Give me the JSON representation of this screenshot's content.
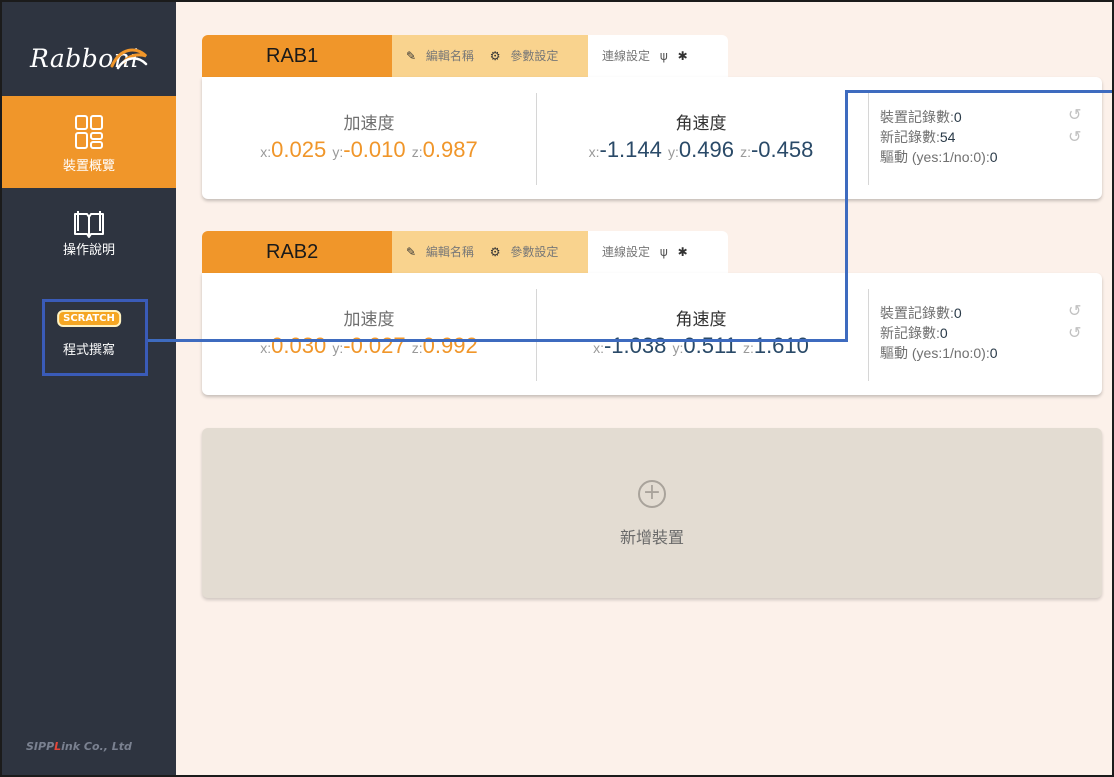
{
  "sidebar": {
    "logo_text": "Rabboni",
    "nav": [
      {
        "label": "裝置概覽",
        "icon": "grid-icon",
        "active": true
      },
      {
        "label": "操作說明",
        "icon": "book-icon",
        "active": false
      },
      {
        "label": "程式撰寫",
        "icon": "scratch-logo",
        "badge": "SCRATCH",
        "active": false
      }
    ],
    "footer": {
      "prefix": "SIPP",
      "accent": "L",
      "suffix": "ink Co., Ltd"
    }
  },
  "devices": [
    {
      "name": "RAB1",
      "actions": {
        "edit_icon": "✎",
        "edit_label": "編輯名稱",
        "settings_icon": "⚙",
        "settings_label": "參數設定"
      },
      "connection": {
        "label": "連線設定",
        "usb_icon": "ψ",
        "bluetooth_icon": "✱"
      },
      "accel": {
        "title": "加速度",
        "x_label": "x:",
        "x": "0.025",
        "y_label": "y:",
        "y": "-0.010",
        "z_label": "z:",
        "z": "0.987"
      },
      "gyro": {
        "title": "角速度",
        "x_label": "x:",
        "x": "-1.144",
        "y_label": "y:",
        "y": "0.496",
        "z_label": "z:",
        "z": "-0.458"
      },
      "stats": {
        "device_records_label": "裝置記錄數:",
        "device_records": "0",
        "new_records_label": "新記錄數:",
        "new_records": "54",
        "driver_label": "驅動 (yes:1/no:0):",
        "driver": "0"
      },
      "reset_icon": "↺"
    },
    {
      "name": "RAB2",
      "actions": {
        "edit_icon": "✎",
        "edit_label": "編輯名稱",
        "settings_icon": "⚙",
        "settings_label": "參數設定"
      },
      "connection": {
        "label": "連線設定",
        "usb_icon": "ψ",
        "bluetooth_icon": "✱"
      },
      "accel": {
        "title": "加速度",
        "x_label": "x:",
        "x": "0.030",
        "y_label": "y:",
        "y": "-0.027",
        "z_label": "z:",
        "z": "0.992"
      },
      "gyro": {
        "title": "角速度",
        "x_label": "x:",
        "x": "-1.038",
        "y_label": "y:",
        "y": "0.511",
        "z_label": "z:",
        "z": "1.610"
      },
      "stats": {
        "device_records_label": "裝置記錄數:",
        "device_records": "0",
        "new_records_label": "新記錄數:",
        "new_records": "0",
        "driver_label": "驅動 (yes:1/no:0):",
        "driver": "0"
      },
      "reset_icon": "↺"
    }
  ],
  "add_device": {
    "icon": "+",
    "label": "新增裝置"
  },
  "colors": {
    "sidebar_bg": "#2e3440",
    "accent": "#f0962a",
    "actions_bg": "#f9d38e",
    "main_bg": "#fcf1ea",
    "gyro_value": "#2a4a68",
    "annotation": "#3e6bbf"
  }
}
